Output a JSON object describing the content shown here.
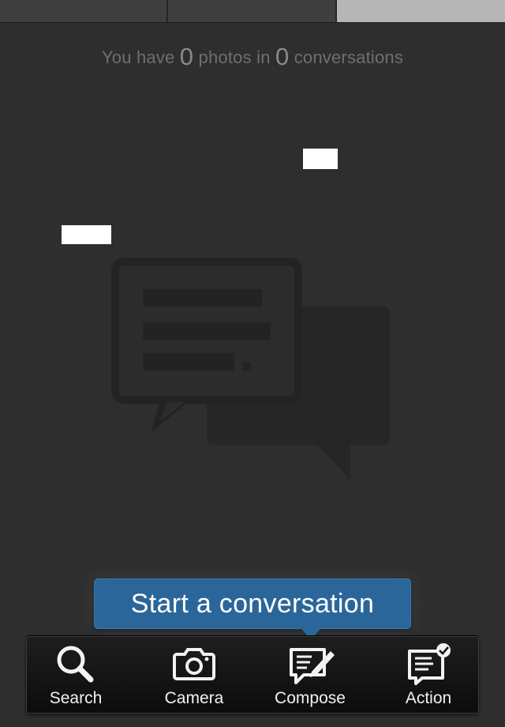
{
  "tabs": [
    {
      "name": "tab-1",
      "selected": false
    },
    {
      "name": "tab-2",
      "selected": false
    },
    {
      "name": "tab-3",
      "selected": true
    }
  ],
  "stats": {
    "prefix": "You have",
    "photos_count": "0",
    "middle": "photos in",
    "conversations_count": "0",
    "suffix": "conversations"
  },
  "tooltip": {
    "label": "Start a conversation"
  },
  "actionbar": {
    "items": [
      {
        "label": "Search",
        "icon": "search-icon"
      },
      {
        "label": "Camera",
        "icon": "camera-icon"
      },
      {
        "label": "Compose",
        "icon": "compose-icon"
      },
      {
        "label": "Action",
        "icon": "action-icon"
      }
    ]
  },
  "colors": {
    "background": "#2e2e2e",
    "tooltip_blue": "#2a6699",
    "selected_tab": "#b7b6b7"
  }
}
